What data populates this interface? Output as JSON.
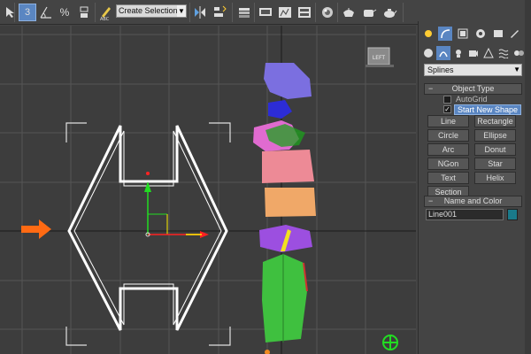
{
  "toolbar": {
    "selection_set_placeholder": "Create Selection Se",
    "icons": [
      "select-object-icon",
      "snap-3d-icon",
      "angle-snap-icon",
      "percent-snap-icon",
      "spinner-snap-icon",
      "edit-named-selection-icon",
      "mirror-icon",
      "align-icon",
      "layer-manager-icon",
      "curve-editor-icon",
      "schematic-view-icon",
      "material-editor-icon",
      "render-setup-icon",
      "rendered-frame-icon",
      "render-icon"
    ],
    "labels": {
      "snap": "3",
      "percent": "%",
      "angle": "A"
    }
  },
  "panel": {
    "category_dropdown": "Splines",
    "object_type": {
      "title": "Object Type",
      "autogrid_label": "AutoGrid",
      "autogrid_checked": false,
      "start_new_shape_label": "Start New Shape",
      "start_new_shape_checked": true,
      "buttons": [
        "Line",
        "Rectangle",
        "Circle",
        "Ellipse",
        "Arc",
        "Donut",
        "NGon",
        "Star",
        "Text",
        "Helix",
        "Section"
      ]
    },
    "name_and_color": {
      "title": "Name and Color",
      "name_value": "Line001",
      "color": "#1a7a8a"
    }
  },
  "viewport": {
    "viewcube_label": "LEFT",
    "colors": {
      "spline": "#ffffff",
      "arrow": "#ff6a13",
      "gizmo_green": "#22dd22",
      "gizmo_red": "#ff2222",
      "gizmo_yellow": "#ffee00"
    }
  }
}
